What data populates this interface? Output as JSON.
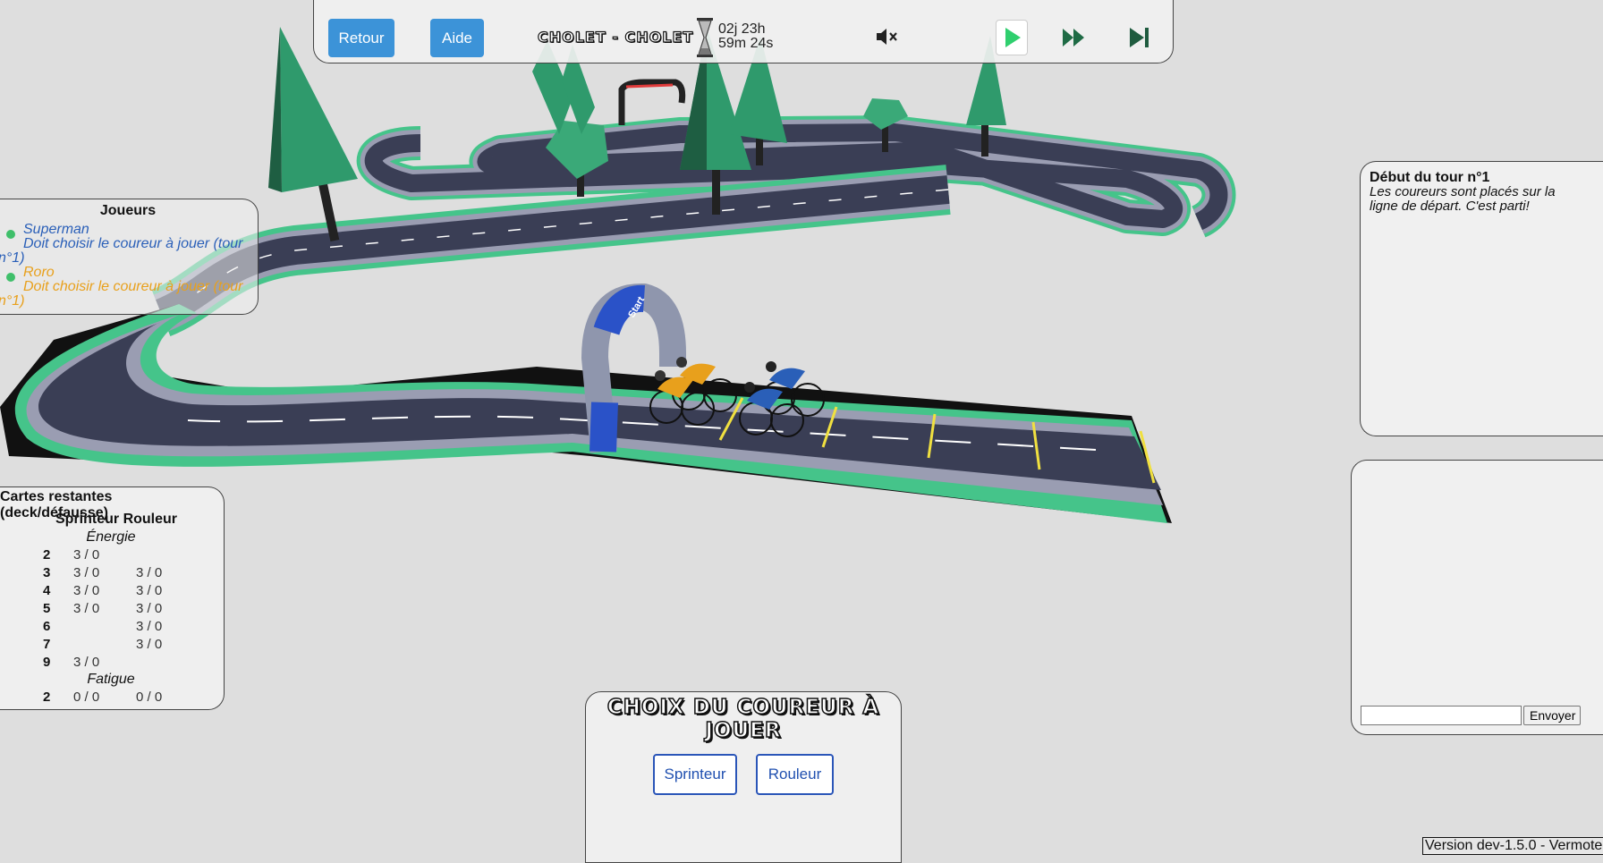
{
  "topbar": {
    "back_label": "Retour",
    "help_label": "Aide",
    "stage_title": "CHOLET - CHOLET",
    "timer_line1": "02j 23h",
    "timer_line2": "59m 24s"
  },
  "players": {
    "title": "Joueurs",
    "list": [
      {
        "name": "Superman",
        "status": "Doit choisir le coureur à jouer (tour n°1)",
        "color": "#2a5fb8"
      },
      {
        "name": "Roro",
        "status": "Doit choisir le coureur à jouer (tour n°1)",
        "color": "#e8a01c"
      }
    ],
    "online_color": "#3fbf6a"
  },
  "cards": {
    "title": "Cartes restantes (deck/défausse)",
    "columns": "Sprinteur Rouleur",
    "energy_label": "Énergie",
    "fatigue_label": "Fatigue",
    "energy_rows": [
      {
        "n": "2",
        "sprinteur": "3 / 0",
        "rouleur": ""
      },
      {
        "n": "3",
        "sprinteur": "3 / 0",
        "rouleur": "3 / 0"
      },
      {
        "n": "4",
        "sprinteur": "3 / 0",
        "rouleur": "3 / 0"
      },
      {
        "n": "5",
        "sprinteur": "3 / 0",
        "rouleur": "3 / 0"
      },
      {
        "n": "6",
        "sprinteur": "",
        "rouleur": "3 / 0"
      },
      {
        "n": "7",
        "sprinteur": "",
        "rouleur": "3 / 0"
      },
      {
        "n": "9",
        "sprinteur": "3 / 0",
        "rouleur": ""
      }
    ],
    "fatigue_rows": [
      {
        "n": "2",
        "sprinteur": "0 / 0",
        "rouleur": "0 / 0"
      }
    ]
  },
  "log": {
    "title": "Début du tour n°1",
    "text": "Les coureurs sont placés sur la ligne de départ. C'est parti!"
  },
  "chat": {
    "input_value": "",
    "send_label": "Envoyer"
  },
  "choose": {
    "title": "CHOIX DU COUREUR À JOUER",
    "options": [
      "Sprinteur",
      "Rouleur"
    ]
  },
  "banner_text": "Start",
  "version": "Version dev-1.5.0 - Vermote",
  "colors": {
    "accent": "#3c93d8",
    "road": "#3a3e55",
    "grass": "#45c48a",
    "pine": "#2f9a6c",
    "arch": "#2a52c8"
  }
}
